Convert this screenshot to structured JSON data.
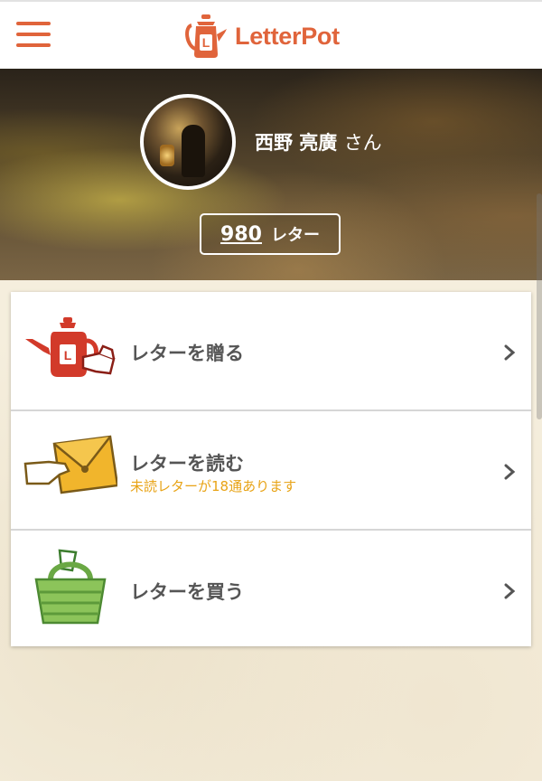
{
  "header": {
    "logo_text": "LetterPot",
    "logo_letter": "L",
    "brand_color": "#e0643b"
  },
  "profile": {
    "name": "西野 亮廣",
    "honorific": "さん",
    "letter_count": "980",
    "letter_unit": "レター"
  },
  "menu": {
    "items": [
      {
        "label": "レターを贈る",
        "icon": "teapot-gift-icon"
      },
      {
        "label": "レターを読む",
        "sub": "未読レターが18通あります",
        "icon": "envelope-hand-icon"
      },
      {
        "label": "レターを買う",
        "icon": "shopping-basket-icon"
      }
    ]
  },
  "colors": {
    "accent": "#e0643b",
    "notice": "#e8a316",
    "text": "#555555"
  }
}
